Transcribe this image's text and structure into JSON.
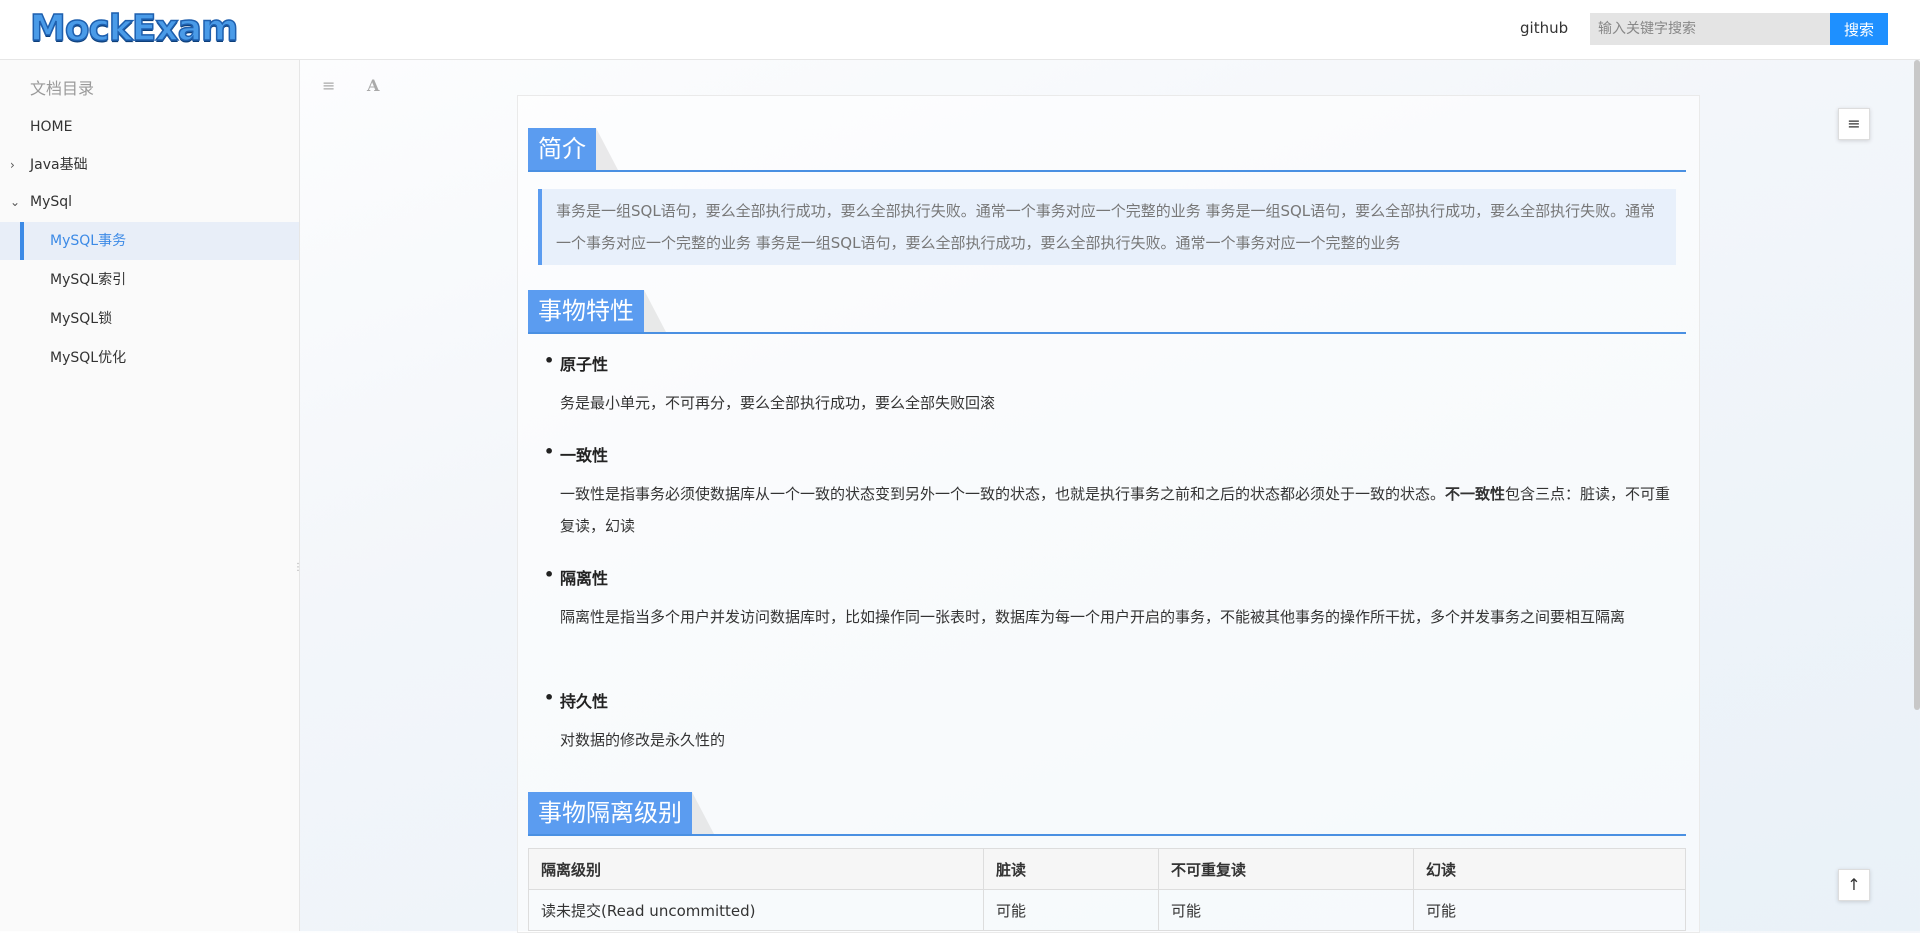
{
  "header": {
    "logo": "MockExam",
    "github_label": "github",
    "search_placeholder": "输入关键字搜索",
    "search_button": "搜索"
  },
  "sidebar": {
    "title": "文档目录",
    "items": [
      {
        "label": "HOME"
      },
      {
        "label": "Java基础",
        "chevron": "›"
      },
      {
        "label": "MySql",
        "chevron": "⌄"
      },
      {
        "label": "MySQL事务"
      },
      {
        "label": "MySQL索引"
      },
      {
        "label": "MySQL锁"
      },
      {
        "label": "MySQL优化"
      }
    ],
    "active": "MySQL事务"
  },
  "toolbar": {
    "menu_icon": "≡",
    "font_icon": "A"
  },
  "content": {
    "intro_title": "简介",
    "intro_text": "事务是一组SQL语句，要么全部执行成功，要么全部执行失败。通常一个事务对应一个完整的业务 事务是一组SQL语句，要么全部执行成功，要么全部执行失败。通常一个事务对应一个完整的业务 事务是一组SQL语句，要么全部执行成功，要么全部执行失败。通常一个事务对应一个完整的业务",
    "props_title": "事物特性",
    "props": [
      {
        "title": "原子性",
        "text": "务是最小单元，不可再分，要么全部执行成功，要么全部失败回滚"
      },
      {
        "title": "一致性",
        "text_before": "一致性是指事务必须使数据库从一个一致的状态变到另外一个一致的状态，也就是执行事务之前和之后的状态都必须处于一致的状态。",
        "text_bold": "不一致性",
        "text_after": "包含三点：脏读，不可重复读，幻读"
      },
      {
        "title": "隔离性",
        "text": "隔离性是指当多个用户并发访问数据库时，比如操作同一张表时，数据库为每一个用户开启的事务，不能被其他事务的操作所干扰，多个并发事务之间要相互隔离"
      },
      {
        "title": "持久性",
        "text": "对数据的修改是永久性的"
      }
    ],
    "isolation_title": "事物隔离级别",
    "table": {
      "headers": [
        "隔离级别",
        "脏读",
        "不可重复读",
        "幻读"
      ],
      "rows": [
        [
          "读未提交(Read uncommitted)",
          "可能",
          "可能",
          "可能"
        ]
      ]
    }
  },
  "float_buttons": {
    "toc_icon": "≡",
    "top_icon": "↑"
  }
}
